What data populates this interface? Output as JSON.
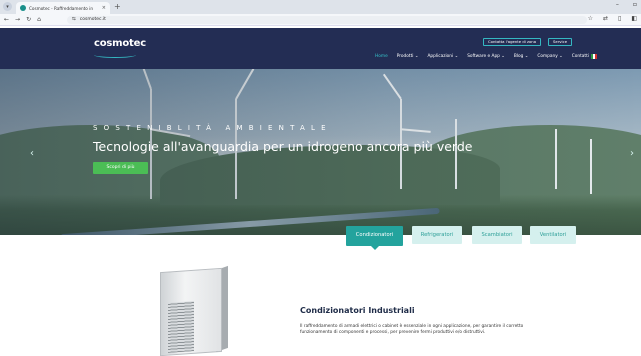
{
  "browser": {
    "tab_title": "Cosmotec - Raffreddamento in",
    "tab_close": "×",
    "new_tab": "+",
    "url": "cosmotec.it",
    "menu_glyph": "▾"
  },
  "header": {
    "logo": "cosmotec",
    "button_ingegneria": "Contatta l'agente di zona",
    "button_service": "Service",
    "nav": [
      "Home",
      "Prodotti ⌄",
      "Applicazioni ⌄",
      "Software e App ⌄",
      "Blog ⌄",
      "Company ⌄",
      "Contatti"
    ],
    "colors": {
      "bg": "#232d54",
      "accent": "#35b8c2"
    }
  },
  "hero": {
    "eyebrow": "SOSTENIBLITÀ AMBIENTALE",
    "title": "Tecnologie all'avanguardia per un idrogeno ancora più verde",
    "cta": "Scopri di più",
    "prev": "‹",
    "next": "›"
  },
  "product_tabs": [
    "Condizionatori",
    "Refrigeratori",
    "Scambiatori",
    "Ventilatori"
  ],
  "content": {
    "title": "Condizionatori Industriali",
    "text": "Il raffreddamento di armadi elettrici o cabinet è essenziale in ogni applicazione, per garantire il corretto funzionamento di componenti e processi, per prevenire fermi produttivi e/o distruttivi."
  }
}
